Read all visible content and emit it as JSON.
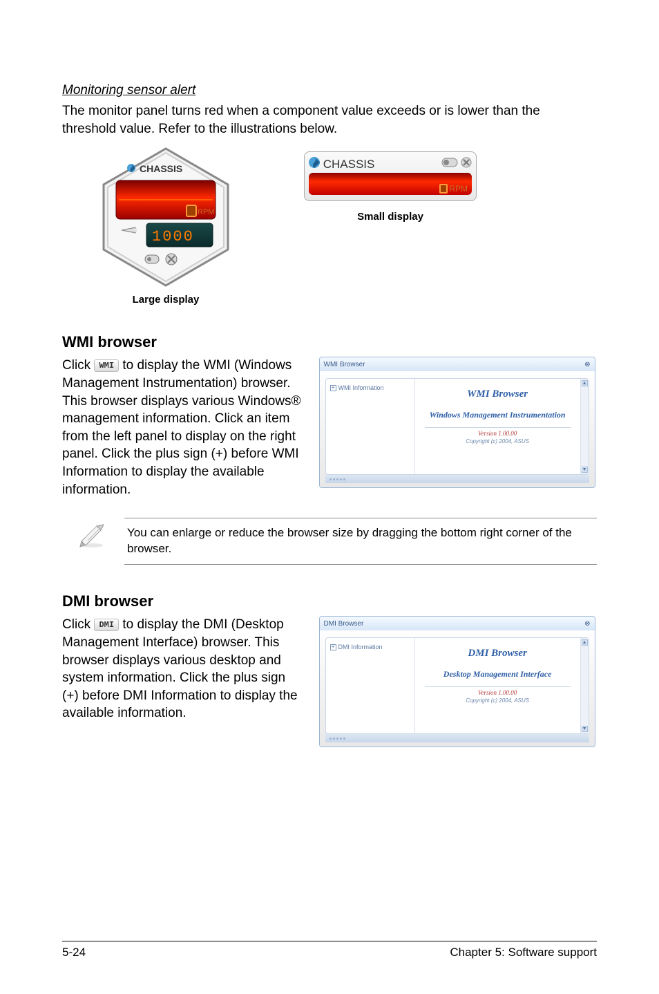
{
  "section1": {
    "title": "Monitoring sensor alert",
    "body": "The monitor panel turns red when a component value exceeds or is lower than the threshold value. Refer to the illustrations below."
  },
  "figures": {
    "large_caption": "Large display",
    "small_caption": "Small display",
    "monitor_label": "CHASSIS",
    "rpm_label": "RPM",
    "digits": "1000"
  },
  "wmi": {
    "heading": "WMI browser",
    "btn_label": "WMI",
    "text_before": "Click ",
    "text_after": " to display the WMI (Windows Management Instrumentation) browser. This browser displays various Windows® management information. Click an item from the left panel to display on the right panel. Click the plus sign (+) before WMI Information to display the available information.",
    "thumb_title": "WMI Browser",
    "thumb_tree": "WMI Information",
    "thumb_brand": "WMI  Browser",
    "thumb_sub": "Windows Management Instrumentation",
    "thumb_ver": "Version 1.00.00",
    "thumb_copy": "Copyright (c) 2004,  ASUS"
  },
  "note": {
    "text": "You can enlarge or reduce the browser size by dragging the bottom right corner of the browser."
  },
  "dmi": {
    "heading": "DMI browser",
    "btn_label": "DMI",
    "text_before": "Click ",
    "text_after": " to display the DMI (Desktop Management Interface) browser. This browser displays various desktop and system information. Click the plus sign (+) before DMI Information to display the available information.",
    "thumb_title": "DMI Browser",
    "thumb_tree": "DMI Information",
    "thumb_brand": "DMI  Browser",
    "thumb_sub": "Desktop Management Interface",
    "thumb_ver": "Version 1.00.00",
    "thumb_copy": "Copyright (c) 2004,  ASUS"
  },
  "footer": {
    "left": "5-24",
    "right": "Chapter 5: Software support"
  }
}
